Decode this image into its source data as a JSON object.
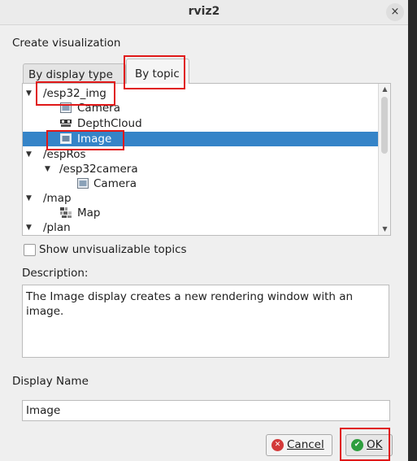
{
  "window": {
    "title": "rviz2",
    "close_glyph": "×"
  },
  "section_label": "Create visualization",
  "tabs": [
    {
      "label": "By display type",
      "active": false
    },
    {
      "label": "By topic",
      "active": true
    }
  ],
  "tree": {
    "rows": [
      {
        "label": "/esp32_img",
        "kind": "topic",
        "expanded": true,
        "selected": false
      },
      {
        "label": "Camera",
        "icon": "camera-display-icon",
        "selected": false
      },
      {
        "label": "DepthCloud",
        "icon": "depthcloud-display-icon",
        "selected": false
      },
      {
        "label": "Image",
        "icon": "image-display-icon",
        "selected": true
      },
      {
        "label": "/espRos",
        "kind": "topic",
        "expanded": true,
        "selected": false
      },
      {
        "label": "/esp32camera",
        "kind": "topic",
        "expanded": true,
        "selected": false
      },
      {
        "label": "Camera",
        "icon": "camera-display-icon",
        "selected": false
      },
      {
        "label": "/map",
        "kind": "topic",
        "expanded": true,
        "selected": false
      },
      {
        "label": "Map",
        "icon": "map-display-icon",
        "selected": false
      },
      {
        "label": "/plan",
        "kind": "topic",
        "expanded": true,
        "selected": false
      }
    ]
  },
  "show_unvisualizable": {
    "label": "Show unvisualizable topics",
    "checked": false
  },
  "description": {
    "label": "Description:",
    "text": "The Image display creates a new rendering window with an image."
  },
  "display_name": {
    "label": "Display Name",
    "value": "Image"
  },
  "buttons": {
    "cancel": "Cancel",
    "ok": "OK"
  },
  "colors": {
    "selection": "#3584c8",
    "highlight": "#e01818",
    "ok_icon": "#2e9e3e",
    "cancel_icon": "#d33a3a"
  }
}
